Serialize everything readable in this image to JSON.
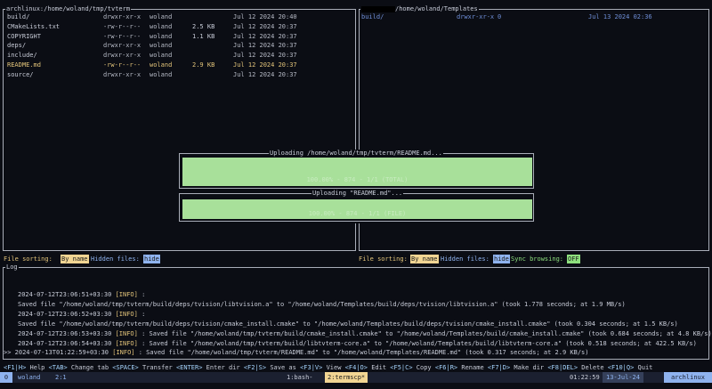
{
  "left_panel": {
    "title": "archlinux:/home/woland/tmp/tvterm",
    "files": [
      {
        "name": "build/",
        "perm": "drwxr-xr-x",
        "owner": "woland",
        "size": "",
        "date": "Jul 12 2024 20:40",
        "type": "dir"
      },
      {
        "name": "CMakeLists.txt",
        "perm": "-rw-r--r--",
        "owner": "woland",
        "size": "2.5 KB",
        "date": "Jul 12 2024 20:37",
        "type": "file"
      },
      {
        "name": "COPYRIGHT",
        "perm": "-rw-r--r--",
        "owner": "woland",
        "size": "1.1 KB",
        "date": "Jul 12 2024 20:37",
        "type": "file"
      },
      {
        "name": "deps/",
        "perm": "drwxr-xr-x",
        "owner": "woland",
        "size": "",
        "date": "Jul 12 2024 20:37",
        "type": "dir"
      },
      {
        "name": "include/",
        "perm": "drwxr-xr-x",
        "owner": "woland",
        "size": "",
        "date": "Jul 12 2024 20:37",
        "type": "dir"
      },
      {
        "name": "README.md",
        "perm": "-rw-r--r--",
        "owner": "woland",
        "size": "2.9 KB",
        "date": "Jul 12 2024 20:37",
        "type": "selected"
      },
      {
        "name": "source/",
        "perm": "drwxr-xr-x",
        "owner": "woland",
        "size": "",
        "date": "Jul 12 2024 20:37",
        "type": "dir"
      }
    ],
    "sorting_label": "File sorting:",
    "sorting_value": "By name",
    "hidden_label": "Hidden files:",
    "hidden_value": "hide"
  },
  "right_panel": {
    "title": "/home/woland/Templates",
    "files": [
      {
        "name": "build/",
        "perm": "drwxr-xr-x",
        "owner": "0",
        "size": "",
        "date": "Jul 13 2024 02:36",
        "type": "selected"
      }
    ],
    "sorting_label": "File sorting:",
    "sorting_value": "By name",
    "hidden_label": "Hidden files:",
    "hidden_value": "hide",
    "sync_label": "Sync browsing:",
    "sync_value": "OFF"
  },
  "upload_dialog": {
    "title1": "Uploading /home/woland/tmp/tvterm/README.md...",
    "progress1_text": "100.00% - 874 - 1/1 (TOTAL)",
    "progress1": 1.0,
    "title2": "Uploading \"README.md\"...",
    "progress2_text": "100.00% - 874 - 1/1 (FILE)",
    "progress2": 1.0
  },
  "log": {
    "title": "Log",
    "lines": [
      {
        "prefix": "",
        "ts": "2024-07-12T23:06:51+03:30",
        "level": "[INFO]",
        "msg": ":"
      },
      {
        "prefix": "",
        "ts": "",
        "level": "",
        "msg": "Saved file \"/home/woland/tmp/tvterm/build/deps/tvision/libtvision.a\" to \"/home/woland/Templates/build/deps/tvision/libtvision.a\" (took 1.778 seconds; at 1.9 MB/s)"
      },
      {
        "prefix": "",
        "ts": "2024-07-12T23:06:52+03:30",
        "level": "[INFO]",
        "msg": ":"
      },
      {
        "prefix": "",
        "ts": "",
        "level": "",
        "msg": "Saved file \"/home/woland/tmp/tvterm/build/deps/tvision/cmake_install.cmake\" to \"/home/woland/Templates/build/deps/tvision/cmake_install.cmake\" (took 0.304 seconds; at 1.5 KB/s)"
      },
      {
        "prefix": "",
        "ts": "2024-07-12T23:06:53+03:30",
        "level": "[INFO]",
        "msg": ": Saved file \"/home/woland/tmp/tvterm/build/cmake_install.cmake\" to \"/home/woland/Templates/build/cmake_install.cmake\" (took 0.684 seconds; at 4.8 KB/s)"
      },
      {
        "prefix": "",
        "ts": "2024-07-12T23:06:54+03:30",
        "level": "[INFO]",
        "msg": ": Saved file \"/home/woland/tmp/tvterm/build/libtvterm-core.a\" to \"/home/woland/Templates/build/libtvterm-core.a\" (took 0.518 seconds; at 422.5 KB/s)"
      },
      {
        "prefix": ">>",
        "ts": "2024-07-13T01:22:59+03:30",
        "level": "[INFO]",
        "msg": ": Saved file \"/home/woland/tmp/tvterm/README.md\" to \"/home/woland/Templates/README.md\" (took 0.317 seconds; at 2.9 KB/s)"
      }
    ]
  },
  "help_bar": [
    {
      "key": "<F1|H>",
      "label": "Help"
    },
    {
      "key": "<TAB>",
      "label": "Change tab"
    },
    {
      "key": "<SPACE>",
      "label": "Transfer"
    },
    {
      "key": "<ENTER>",
      "label": "Enter dir"
    },
    {
      "key": "<F2|S>",
      "label": "Save as"
    },
    {
      "key": "<F3|V>",
      "label": "View"
    },
    {
      "key": "<F4|O>",
      "label": "Edit"
    },
    {
      "key": "<F5|C>",
      "label": "Copy"
    },
    {
      "key": "<F6|R>",
      "label": "Rename"
    },
    {
      "key": "<F7|D>",
      "label": "Make dir"
    },
    {
      "key": "<F8|DEL>",
      "label": "Delete"
    },
    {
      "key": "<F10|Q>",
      "label": "Quit"
    }
  ],
  "statusbar": {
    "session": "0",
    "user": "woland",
    "pane": "2:1",
    "window1": "1:bash-",
    "window2": "2:termscp*",
    "time": "01:22:59",
    "date": "13-Jul-24",
    "host": "archlinux"
  },
  "colors": {
    "background": "#0b0d14",
    "selected_row": "#e3c47a",
    "directory_blue": "#6f8fd8",
    "progress_green": "#a8e09a",
    "status_green": "#8ee07e"
  }
}
